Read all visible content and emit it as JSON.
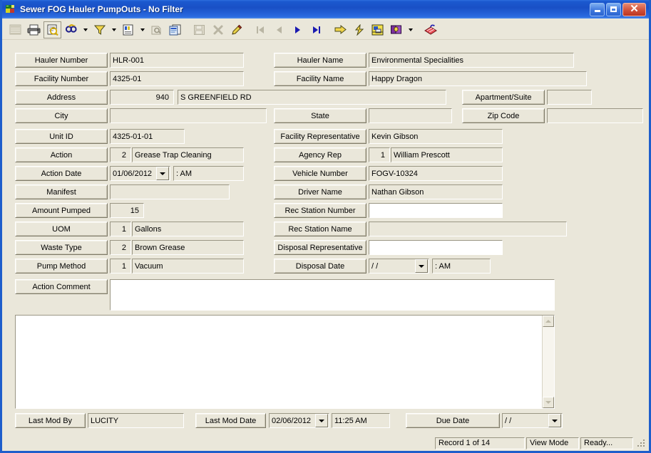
{
  "window": {
    "title": "Sewer FOG Hauler PumpOuts - No Filter",
    "app_icon": "application-icon",
    "buttons": {
      "minimize": "minimize-button",
      "maximize": "maximize-button",
      "close": "close-button"
    },
    "accent": "#1950c6",
    "face": "#eae7da"
  },
  "toolbar": {
    "items": [
      {
        "name": "grid-view-icon",
        "label": "Grid View",
        "framed": false,
        "enabled": false
      },
      {
        "name": "print-icon",
        "label": "Print",
        "framed": false,
        "enabled": true
      },
      {
        "name": "print-preview-icon",
        "label": "Print Preview",
        "framed": true,
        "enabled": true
      },
      {
        "name": "find-icon",
        "label": "Find",
        "framed": false,
        "enabled": true
      },
      {
        "name": "find-dropdown-icon",
        "label": "Find Options",
        "framed": false,
        "enabled": true,
        "dropdown": true
      },
      {
        "name": "filter-icon",
        "label": "Filter",
        "framed": false,
        "enabled": true
      },
      {
        "name": "filter-dropdown-icon",
        "label": "Filter Options",
        "framed": false,
        "enabled": true,
        "dropdown": true
      },
      {
        "name": "report-icon",
        "label": "Reports",
        "framed": false,
        "enabled": true
      },
      {
        "name": "report-dropdown-icon",
        "label": "Report Options",
        "framed": false,
        "enabled": true,
        "dropdown": true
      },
      {
        "name": "properties-icon",
        "label": "Properties",
        "framed": false,
        "enabled": false
      },
      {
        "name": "copy-record-icon",
        "label": "Copy Record",
        "framed": false,
        "enabled": true
      },
      {
        "sep": true
      },
      {
        "name": "save-icon",
        "label": "Save",
        "framed": false,
        "enabled": false
      },
      {
        "name": "delete-icon",
        "label": "Delete",
        "framed": false,
        "enabled": false
      },
      {
        "name": "edit-pencil-icon",
        "label": "Edit",
        "framed": false,
        "enabled": true
      },
      {
        "sep": true
      },
      {
        "name": "first-record-icon",
        "label": "First Record",
        "framed": false,
        "enabled": false
      },
      {
        "name": "previous-record-icon",
        "label": "Previous Record",
        "framed": false,
        "enabled": false
      },
      {
        "name": "next-record-icon",
        "label": "Next Record",
        "framed": false,
        "enabled": true
      },
      {
        "name": "last-record-icon",
        "label": "Last Record",
        "framed": false,
        "enabled": true
      },
      {
        "sep": true
      },
      {
        "name": "goto-icon",
        "label": "Go To",
        "framed": false,
        "enabled": true
      },
      {
        "name": "workflow-icon",
        "label": "Workflow",
        "framed": false,
        "enabled": true
      },
      {
        "name": "gis-map-icon",
        "label": "GIS Map",
        "framed": false,
        "enabled": true
      },
      {
        "name": "book-icon",
        "label": "Documents",
        "framed": false,
        "enabled": true
      },
      {
        "name": "book-dropdown-icon",
        "label": "Document Options",
        "framed": false,
        "enabled": true,
        "dropdown": true
      },
      {
        "sep": true
      },
      {
        "name": "attachment-icon",
        "label": "Attachments",
        "framed": false,
        "enabled": true
      }
    ]
  },
  "form": {
    "hauler_number": {
      "label": "Hauler Number",
      "value": "HLR-001"
    },
    "hauler_name": {
      "label": "Hauler Name",
      "value": "Environmental Specialities"
    },
    "facility_number": {
      "label": "Facility Number",
      "value": "4325-01"
    },
    "facility_name": {
      "label": "Facility Name",
      "value": "Happy Dragon"
    },
    "address": {
      "label": "Address",
      "number": "940",
      "street": "S GREENFIELD RD"
    },
    "apartment_suite": {
      "label": "Apartment/Suite",
      "value": ""
    },
    "city": {
      "label": "City",
      "value": ""
    },
    "state": {
      "label": "State",
      "value": ""
    },
    "zip_code": {
      "label": "Zip Code",
      "value": ""
    },
    "unit_id": {
      "label": "Unit ID",
      "value": "4325-01-01"
    },
    "facility_representative": {
      "label": "Facility Representative",
      "value": "Kevin Gibson"
    },
    "action": {
      "label": "Action",
      "code": "2",
      "value": "Grease Trap Cleaning"
    },
    "agency_rep": {
      "label": "Agency Rep",
      "code": "1",
      "value": "William Prescott"
    },
    "action_date": {
      "label": "Action Date",
      "date": "01/06/2012",
      "time": ":     AM"
    },
    "vehicle_number": {
      "label": "Vehicle Number",
      "value": "FOGV-10324"
    },
    "manifest": {
      "label": "Manifest",
      "value": ""
    },
    "driver_name": {
      "label": "Driver Name",
      "value": "Nathan Gibson"
    },
    "amount_pumped": {
      "label": "Amount Pumped",
      "value": "15"
    },
    "rec_station_number": {
      "label": "Rec Station Number",
      "value": ""
    },
    "uom": {
      "label": "UOM",
      "code": "1",
      "value": "Gallons"
    },
    "rec_station_name": {
      "label": "Rec Station Name",
      "value": ""
    },
    "waste_type": {
      "label": "Waste Type",
      "code": "2",
      "value": "Brown Grease"
    },
    "disposal_representative": {
      "label": "Disposal Representative",
      "value": ""
    },
    "pump_method": {
      "label": "Pump Method",
      "code": "1",
      "value": "Vacuum"
    },
    "disposal_date": {
      "label": "Disposal Date",
      "date": "  /   /",
      "time": ":     AM"
    },
    "action_comment": {
      "label": "Action Comment",
      "value": ""
    },
    "notes": {
      "value": ""
    },
    "last_mod_by": {
      "label": "Last Mod By",
      "value": "LUCITY"
    },
    "last_mod_date": {
      "label": "Last Mod Date",
      "date": "02/06/2012",
      "time": "11:25 AM"
    },
    "due_date": {
      "label": "Due Date",
      "date": "  /   /"
    }
  },
  "statusbar": {
    "record": "Record 1 of 14",
    "mode": "View Mode",
    "state": "Ready..."
  }
}
